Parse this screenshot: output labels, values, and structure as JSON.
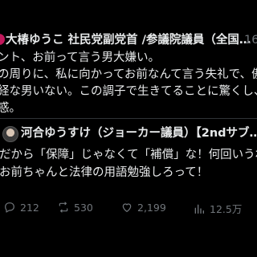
{
  "quoted_tweet": {
    "author_line": "大椿ゆうこ 社民党副党首 /参議院議員（全国…",
    "time": "16",
    "lines": [
      "ント、お前って言う男大嫌い。",
      "の周りに、私に向かってお前なんて言う失礼で、傲",
      "経な男いない。この調子で生きてることに驚くし、",
      "惑。"
    ]
  },
  "reply": {
    "author": "河合ゆうすけ（ジョーカー議員）【2ndサブ…",
    "lines": [
      "だから「保障」じゃなくて「補償」な！何回いうね",
      "お前ちゃんと法律の用語勉強しろって！"
    ]
  },
  "actions": {
    "replies": "212",
    "reposts": "530",
    "likes": "2,199",
    "views": "12.5万"
  }
}
